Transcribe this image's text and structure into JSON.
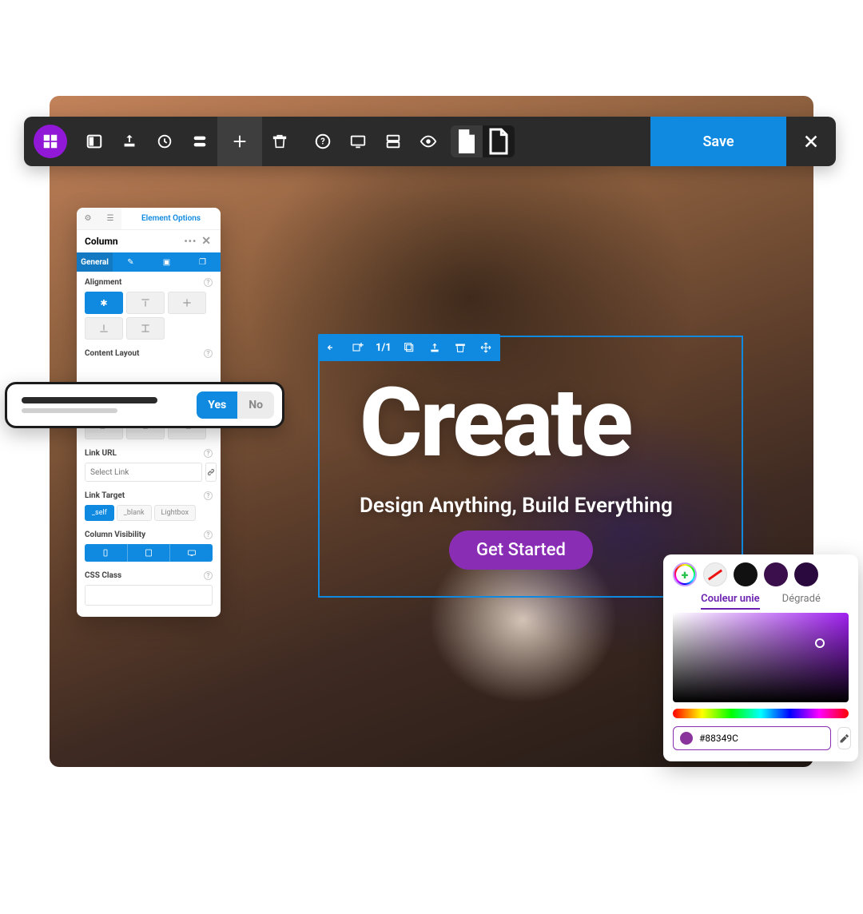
{
  "toolbar": {
    "save_label": "Save"
  },
  "panel": {
    "tab_options": "Element Options",
    "title": "Column",
    "subtabs": {
      "general": "General"
    },
    "sections": {
      "alignment": "Alignment",
      "content_layout": "Content Layout",
      "link_url": "Link URL",
      "link_url_placeholder": "Select Link",
      "link_target": "Link Target",
      "targets": {
        "self": "_self",
        "blank": "_blank",
        "lightbox": "Lightbox"
      },
      "column_visibility": "Column Visibility",
      "css_class": "CSS Class"
    }
  },
  "confirm": {
    "yes": "Yes",
    "no": "No"
  },
  "selection": {
    "count": "1/1"
  },
  "hero": {
    "title": "Create",
    "subtitle": "Design Anything, Build Everything",
    "cta": "Get Started"
  },
  "picker": {
    "tab_solid": "Couleur unie",
    "tab_gradient": "Dégradé",
    "hex": "#88349C",
    "swatches": [
      "#111111",
      "#3a0f4b",
      "#2a0a3e",
      "#a24be0"
    ]
  }
}
